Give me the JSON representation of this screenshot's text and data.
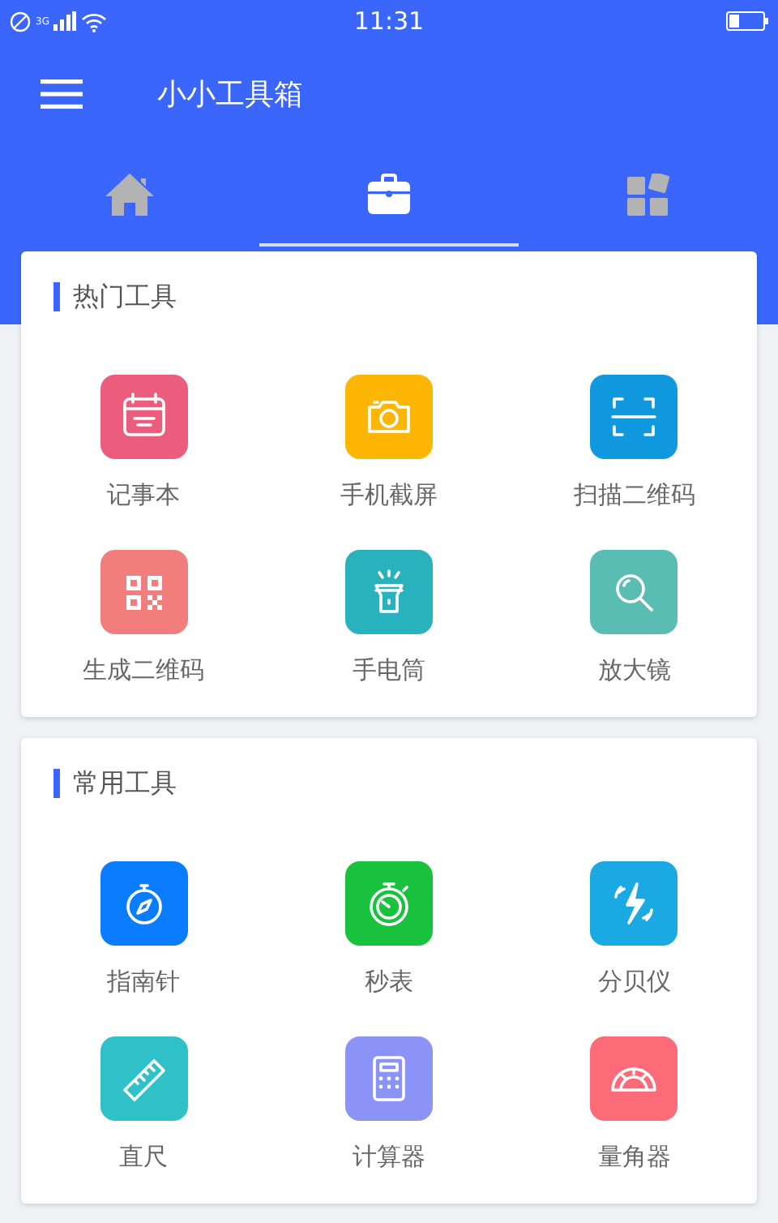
{
  "status_bar": {
    "network": "3G",
    "time": "11:31"
  },
  "app_bar": {
    "title": "小小工具箱"
  },
  "tabs": [
    {
      "selected": false
    },
    {
      "selected": true
    },
    {
      "selected": false
    }
  ],
  "sections": [
    {
      "title": "热门工具",
      "tools": [
        {
          "label": "记事本",
          "color": "#ec5c7c"
        },
        {
          "label": "手机截屏",
          "color": "#fdb603"
        },
        {
          "label": "扫描二维码",
          "color": "#1199df"
        },
        {
          "label": "生成二维码",
          "color": "#f27d7d"
        },
        {
          "label": "手电筒",
          "color": "#27b2bd"
        },
        {
          "label": "放大镜",
          "color": "#5abdb3"
        }
      ]
    },
    {
      "title": "常用工具",
      "tools": [
        {
          "label": "指南针",
          "color": "#0a7cff"
        },
        {
          "label": "秒表",
          "color": "#18c23c"
        },
        {
          "label": "分贝仪",
          "color": "#1aa9e3"
        },
        {
          "label": "直尺",
          "color": "#30c0c8"
        },
        {
          "label": "计算器",
          "color": "#8b93f6"
        },
        {
          "label": "量角器",
          "color": "#fd6b78"
        }
      ]
    }
  ]
}
